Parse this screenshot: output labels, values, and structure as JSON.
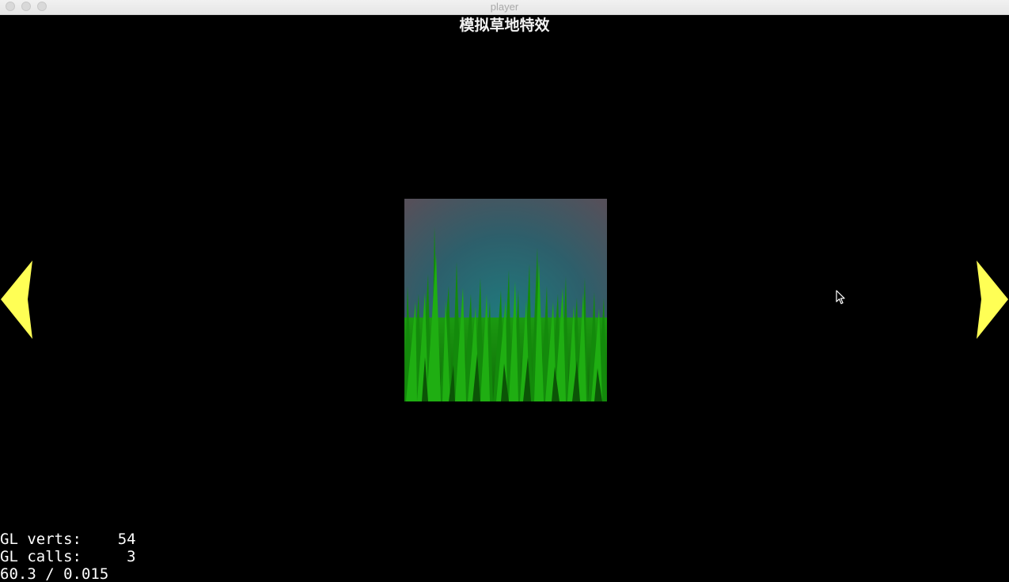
{
  "window": {
    "title": "player"
  },
  "scene": {
    "title": "模拟草地特效",
    "preview_icon": "grass-field-icon"
  },
  "navigation": {
    "prev_icon": "arrow-left-icon",
    "next_icon": "arrow-right-icon",
    "arrow_color": "#ffff55"
  },
  "stats": {
    "verts_line": "GL verts:    54",
    "calls_line": "GL calls:     3",
    "fps_line": "60.3 / 0.015"
  },
  "colors": {
    "background": "#000000",
    "grass": "#1a9a0c",
    "sky": "#2e6a74"
  }
}
